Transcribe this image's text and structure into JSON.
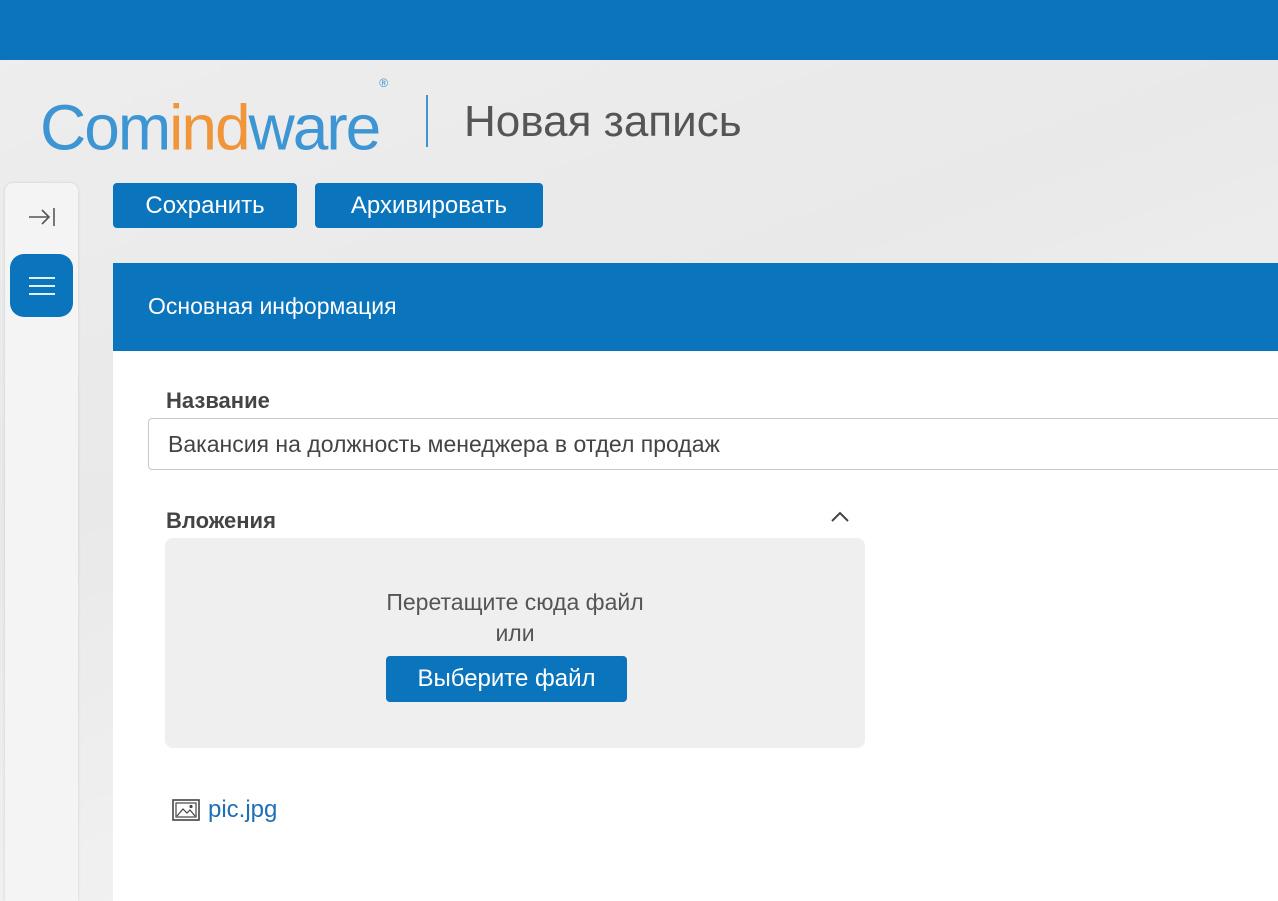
{
  "header": {
    "logo": {
      "part1": "Com",
      "part2": "ind",
      "part3": "ware",
      "mark": "®"
    },
    "title": "Новая запись"
  },
  "sidebar": {
    "collapse_icon": "collapse-right-icon",
    "menu_icon": "hamburger-menu-icon"
  },
  "toolbar": {
    "save_label": "Сохранить",
    "archive_label": "Архивировать"
  },
  "section": {
    "title": "Основная информация"
  },
  "fields": {
    "name_label": "Название",
    "name_value": "Вакансия на должность менеджера в отдел продаж",
    "attachments_label": "Вложения"
  },
  "dropzone": {
    "line1": "Перетащите сюда файл",
    "line2": "или",
    "choose_label": "Выберите файл"
  },
  "attachments": [
    {
      "name": "pic.jpg",
      "icon": "image-file-icon"
    }
  ],
  "colors": {
    "primary": "#0a74bd",
    "logo_blue": "#3d95d3",
    "logo_orange": "#f0953a"
  }
}
